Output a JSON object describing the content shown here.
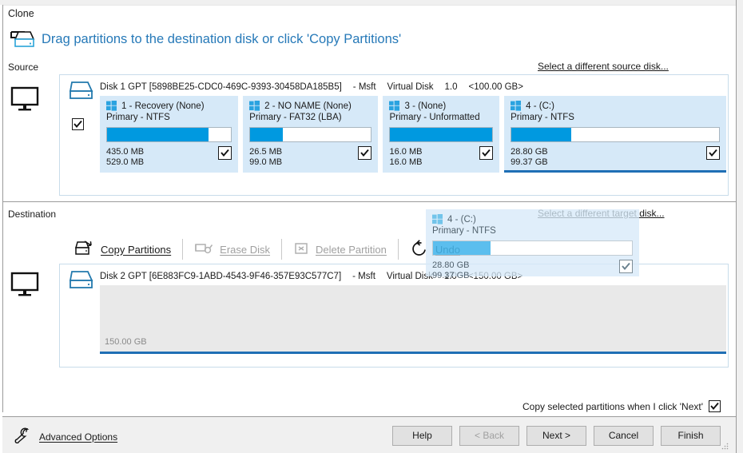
{
  "window": {
    "title": "Clone",
    "headline": "Drag partitions to the destination disk or click 'Copy Partitions'"
  },
  "source": {
    "side_label": "Source",
    "link_label": "Select a different source disk...",
    "disk": {
      "name": "Disk 1 GPT [5898BE25-CDC0-469C-9393-30458DA185B5]",
      "vendor": "- Msft",
      "type": "Virtual Disk",
      "version": "1.0",
      "capacity": "<100.00 GB>",
      "checked": true
    },
    "partitions": [
      {
        "title": "1 - Recovery (None)",
        "subtitle": "Primary - NTFS",
        "used": "435.0 MB",
        "total": "529.0 MB",
        "fill_pct": 82,
        "checked": true,
        "selected": false,
        "width_pct": 22.6
      },
      {
        "title": "2 - NO NAME (None)",
        "subtitle": "Primary - FAT32 (LBA)",
        "used": "26.5 MB",
        "total": "99.0 MB",
        "fill_pct": 27,
        "checked": true,
        "selected": false,
        "width_pct": 22.1
      },
      {
        "title": "3 -  (None)",
        "subtitle": "Primary - Unformatted",
        "used": "16.0 MB",
        "total": "16.0 MB",
        "fill_pct": 100,
        "checked": true,
        "selected": false,
        "width_pct": 19.0
      },
      {
        "title": "4 -  (C:)",
        "subtitle": "Primary - NTFS",
        "used": "28.80 GB",
        "total": "99.37 GB",
        "fill_pct": 29,
        "checked": true,
        "selected": true,
        "width_pct": 36.3
      }
    ]
  },
  "destination": {
    "side_label": "Destination",
    "link_label": "Select a different target disk...",
    "disk": {
      "name": "Disk 2 GPT [6E883FC9-1ABD-4543-9F46-357E93C577C7]",
      "vendor": "- Msft",
      "type": "Virtual Disk",
      "version": "1.0",
      "capacity": "<150.00 GB>",
      "free_label": "150.00 GB"
    }
  },
  "toolbar": {
    "copy_partitions": "Copy Partitions",
    "erase_disk": "Erase Disk",
    "delete_partition": "Delete Partition",
    "undo": "Undo"
  },
  "drag_ghost": {
    "title": "4 -  (C:)",
    "subtitle": "Primary - NTFS",
    "used": "28.80 GB",
    "total": "99.37 GB",
    "fill_pct": 29,
    "checked": true
  },
  "footer": {
    "copy_note": "Copy selected partitions when I click 'Next'",
    "copy_note_checked": true,
    "advanced_options": "Advanced Options",
    "buttons": [
      {
        "label": "Help",
        "enabled": true
      },
      {
        "label": "< Back",
        "enabled": false
      },
      {
        "label": "Next >",
        "enabled": true
      },
      {
        "label": "Cancel",
        "enabled": true
      },
      {
        "label": "Finish",
        "enabled": true
      }
    ]
  },
  "colors": {
    "accent_blue": "#2679b8",
    "bar_fill": "#0099e0",
    "partition_bg": "#d6e9f8",
    "selected_underline": "#1f6fb5"
  }
}
